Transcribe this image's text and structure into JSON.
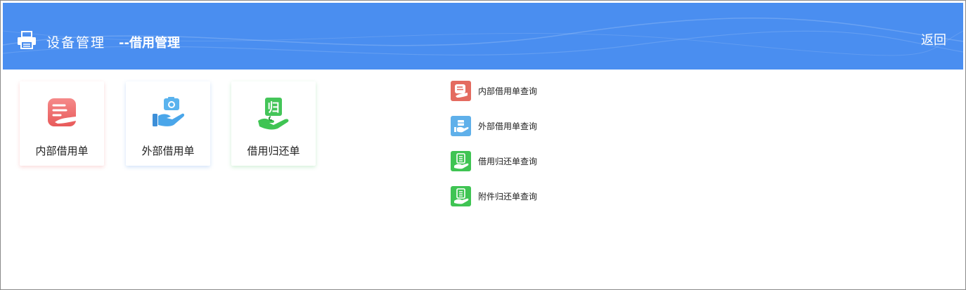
{
  "header": {
    "icon": "printer-icon",
    "title": "设备管理",
    "subtitle": "--借用管理",
    "back_label": "返回",
    "bg_color": "#4a8ef0"
  },
  "cards": [
    {
      "label": "内部借用单",
      "icon": "hand-document-icon",
      "color": "#ee6b6b"
    },
    {
      "label": "外部借用单",
      "icon": "hand-camera-icon",
      "color": "#4aa6ea"
    },
    {
      "label": "借用归还单",
      "icon": "hand-return-icon",
      "color": "#3fc453"
    }
  ],
  "queries": [
    {
      "label": "内部借用单查询",
      "icon": "hand-document-icon",
      "color": "#e46b60"
    },
    {
      "label": "外部借用单查询",
      "icon": "hand-box-icon",
      "color": "#5fb0ea"
    },
    {
      "label": "借用归还单查询",
      "icon": "hand-return-icon",
      "color": "#3fc453"
    },
    {
      "label": "附件归还单查询",
      "icon": "hand-return-icon",
      "color": "#3fc453"
    }
  ]
}
